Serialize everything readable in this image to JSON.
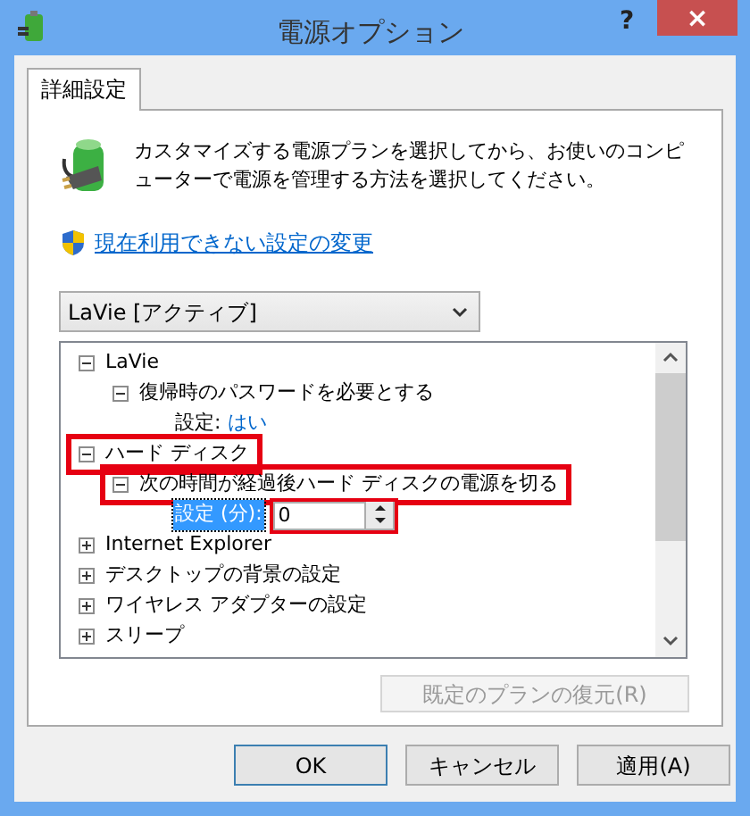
{
  "window": {
    "title": "電源オプション",
    "help": "?",
    "close": "×"
  },
  "tabs": [
    {
      "label": "詳細設定",
      "selected": true
    }
  ],
  "description": "カスタマイズする電源プランを選択してから、お使いのコンピューターで電源を管理する方法を選択してください。",
  "admin_link": "現在利用できない設定の変更",
  "plan_dropdown": {
    "value": "LaVie [アクティブ]"
  },
  "tree": [
    {
      "label": "LaVie",
      "kind": "node",
      "expanded": true,
      "annotated": false,
      "children": [
        {
          "label": "復帰時のパスワードを必要とする",
          "kind": "node",
          "expanded": true,
          "annotated": false,
          "children": [
            {
              "kind": "setting",
              "label": "設定:",
              "value": "はい",
              "selected": false
            }
          ]
        }
      ]
    },
    {
      "label": "ハード ディスク",
      "kind": "node",
      "expanded": true,
      "annotated": true,
      "children": [
        {
          "label": "次の時間が経過後ハード ディスクの電源を切る",
          "kind": "node",
          "expanded": true,
          "annotated": true,
          "children": [
            {
              "kind": "spin",
              "label": "設定 (分):",
              "value": "0",
              "selected": true,
              "annotated": true
            }
          ]
        }
      ]
    },
    {
      "label": "Internet Explorer",
      "kind": "node",
      "expanded": false,
      "annotated": false
    },
    {
      "label": "デスクトップの背景の設定",
      "kind": "node",
      "expanded": false,
      "annotated": false
    },
    {
      "label": "ワイヤレス アダプターの設定",
      "kind": "node",
      "expanded": false,
      "annotated": false
    },
    {
      "label": "スリープ",
      "kind": "node",
      "expanded": false,
      "annotated": false
    }
  ],
  "restore_button": {
    "label": "既定のプランの復元(R)",
    "disabled": true
  },
  "buttons": [
    {
      "label": "OK",
      "default": true
    },
    {
      "label": "キャンセル",
      "default": false
    },
    {
      "label": "適用(A)",
      "default": false
    }
  ]
}
